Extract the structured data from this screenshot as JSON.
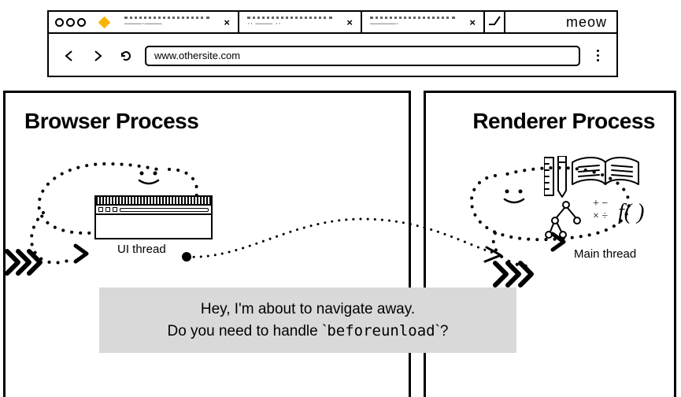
{
  "browser": {
    "brand": "meow",
    "url": "www.othersite.com",
    "tabs": [
      {
        "label": "——·——"
      },
      {
        "label": "·· —— ··"
      },
      {
        "label": "———·"
      }
    ]
  },
  "left_process": {
    "title": "Browser Process",
    "thread_label": "UI thread"
  },
  "right_process": {
    "title": "Renderer Process",
    "thread_label": "Main thread"
  },
  "message": {
    "line1": "Hey, I'm about to navigate away.",
    "line2_pre": "Do you need to handle ",
    "line2_code": "beforeunload",
    "line2_post": "?"
  }
}
